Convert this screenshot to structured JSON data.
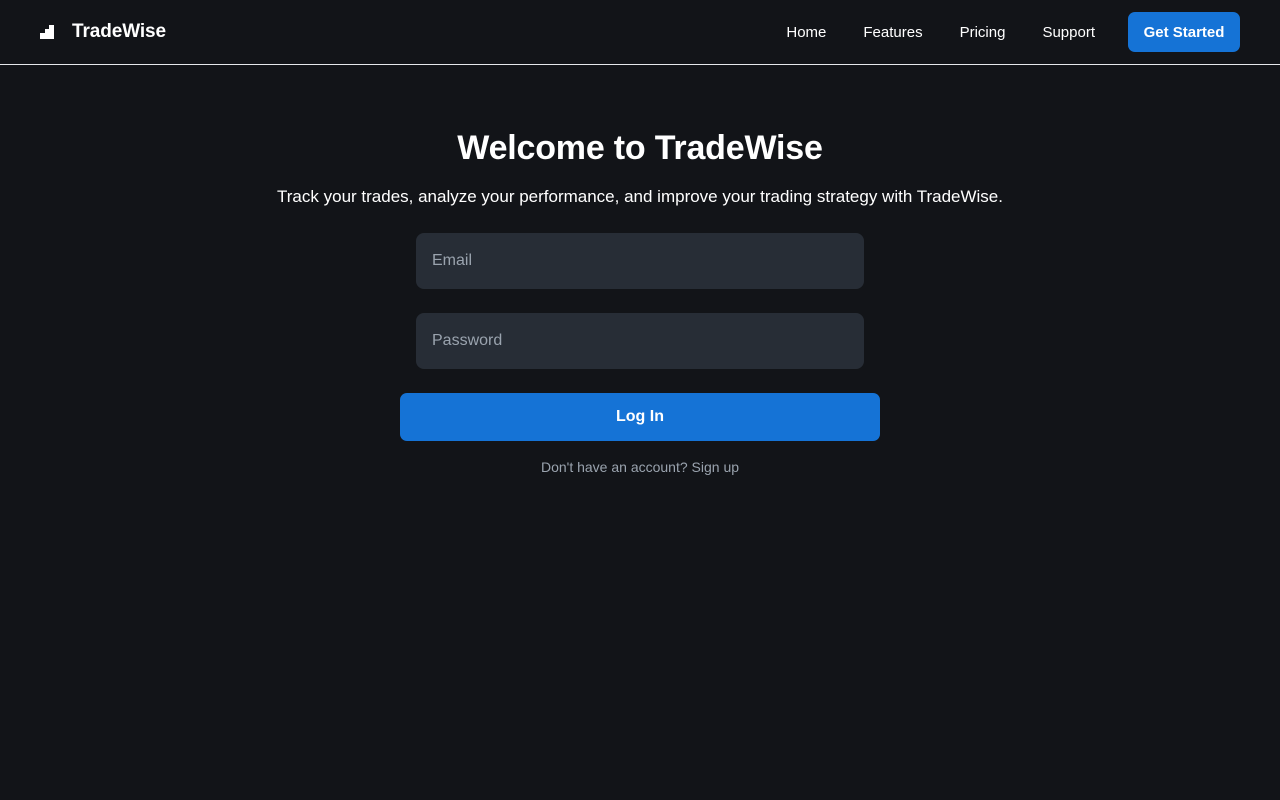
{
  "brand": {
    "name": "TradeWise",
    "icon": "stairs-chart-icon"
  },
  "nav": {
    "links": [
      "Home",
      "Features",
      "Pricing",
      "Support"
    ],
    "cta_label": "Get Started"
  },
  "hero": {
    "title": "Welcome to TradeWise",
    "subtitle": "Track your trades, analyze your performance, and improve your trading strategy with TradeWise."
  },
  "form": {
    "email_placeholder": "Email",
    "email_value": "",
    "password_placeholder": "Password",
    "password_value": "",
    "login_label": "Log In",
    "signup_prompt": "Don't have an account?",
    "signup_link": "Sign up"
  },
  "colors": {
    "background": "#121418",
    "accent": "#1573d6",
    "input_background": "#272d36",
    "muted_text": "#9aa3ae"
  }
}
